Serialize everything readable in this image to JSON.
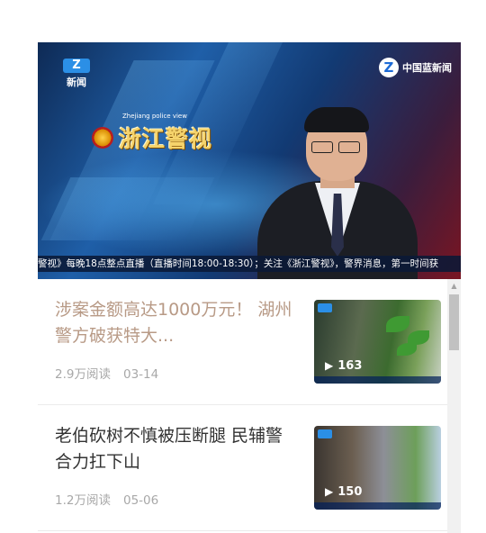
{
  "video": {
    "channel_logo_text": "新闻",
    "channel_logo_mark": "Z",
    "brand_text": "中国蓝新闻",
    "program_en": "Zhejiang police view",
    "program_cn": "浙江警视",
    "ticker": "警视》每晚18点整点直播（直播时间18:00-18:30）；关注《浙江警视》，警界消息，第一时间获"
  },
  "articles": [
    {
      "title": "涉案金额高达1000万元！ 湖州警方破获特大...",
      "title_color": "#b89a86",
      "reads": "2.9万阅读",
      "date": "03-14",
      "plays": "163"
    },
    {
      "title": "老伯砍树不慎被压断腿 民辅警合力扛下山",
      "title_color": "#333333",
      "reads": "1.2万阅读",
      "date": "05-06",
      "plays": "150"
    }
  ],
  "icons": {
    "play": "play-icon",
    "scroll_up": "scroll-up-arrow-icon"
  }
}
